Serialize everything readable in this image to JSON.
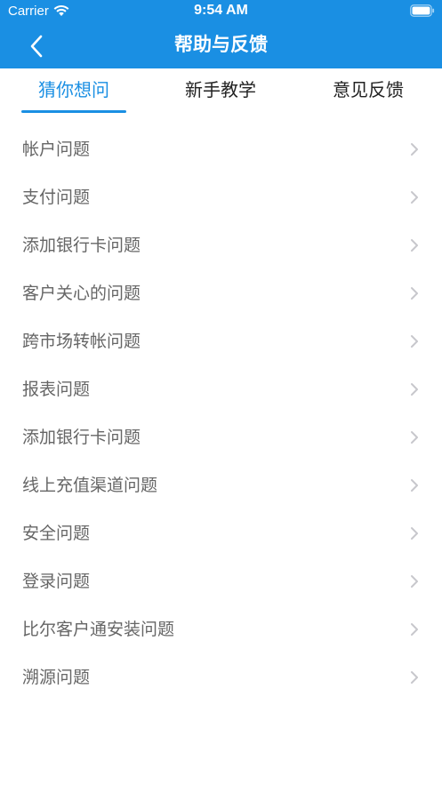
{
  "status_bar": {
    "carrier": "Carrier",
    "time": "9:54 AM"
  },
  "nav": {
    "title": "帮助与反馈",
    "back_icon": "chevron-left-icon"
  },
  "tabs": [
    {
      "label": "猜你想问",
      "active": true
    },
    {
      "label": "新手教学",
      "active": false
    },
    {
      "label": "意见反馈",
      "active": false
    }
  ],
  "list": {
    "items": [
      {
        "label": "帐户问题"
      },
      {
        "label": "支付问题"
      },
      {
        "label": "添加银行卡问题"
      },
      {
        "label": "客户关心的问题"
      },
      {
        "label": "跨市场转帐问题"
      },
      {
        "label": "报表问题"
      },
      {
        "label": "添加银行卡问题"
      },
      {
        "label": "线上充值渠道问题"
      },
      {
        "label": "安全问题"
      },
      {
        "label": "登录问题"
      },
      {
        "label": "比尔客户通安装问题"
      },
      {
        "label": "溯源问题"
      }
    ],
    "item_icon": "chevron-right-icon"
  },
  "colors": {
    "accent": "#1a8fe3",
    "item_text": "#666666",
    "chevron": "#c7c7cc"
  }
}
